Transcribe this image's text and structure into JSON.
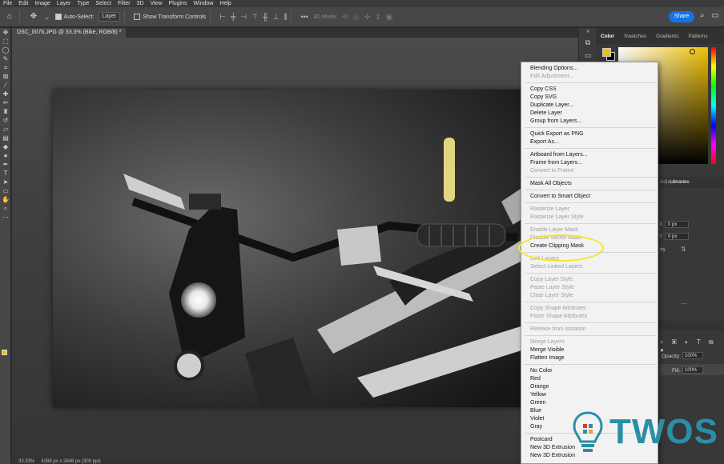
{
  "menubar": {
    "items": [
      "File",
      "Edit",
      "Image",
      "Layer",
      "Type",
      "Select",
      "Filter",
      "3D",
      "View",
      "Plugins",
      "Window",
      "Help"
    ]
  },
  "options": {
    "auto_select_label": "Auto-Select:",
    "auto_select_value": "Layer",
    "show_transform_label": "Show Transform Controls",
    "mode_3d_label": "3D Mode:",
    "share_label": "Share"
  },
  "document": {
    "tab_title": "DSC_0076.JPG @ 33.3% (Bike, RGB/8) *",
    "status_zoom": "33.33%",
    "status_info": "4288 px x 2848 px (300 ppi)"
  },
  "right_panel": {
    "tabs": [
      "Color",
      "Swatches",
      "Gradients",
      "Patterns"
    ],
    "active_tab": "Color",
    "lib_tabs": [
      "Adjustments",
      "Libraries"
    ],
    "x_label": "X",
    "x_value": "0 px",
    "y_label": "Y",
    "y_value": "0 px",
    "opacity_label": "Opacity:",
    "opacity_value": "100%",
    "fill_label": "Fill:",
    "fill_value": "100%"
  },
  "context_menu": {
    "groups": [
      [
        {
          "label": "Blending Options...",
          "enabled": true
        },
        {
          "label": "Edit Adjustment...",
          "enabled": false
        }
      ],
      [
        {
          "label": "Copy CSS",
          "enabled": true
        },
        {
          "label": "Copy SVG",
          "enabled": true
        },
        {
          "label": "Duplicate Layer...",
          "enabled": true
        },
        {
          "label": "Delete Layer",
          "enabled": true
        },
        {
          "label": "Group from Layers...",
          "enabled": true
        }
      ],
      [
        {
          "label": "Quick Export as PNG",
          "enabled": true
        },
        {
          "label": "Export As...",
          "enabled": true
        }
      ],
      [
        {
          "label": "Artboard from Layers...",
          "enabled": true
        },
        {
          "label": "Frame from Layers...",
          "enabled": true
        },
        {
          "label": "Convert to Frame",
          "enabled": false
        }
      ],
      [
        {
          "label": "Mask All Objects",
          "enabled": true
        }
      ],
      [
        {
          "label": "Convert to Smart Object",
          "enabled": true
        }
      ],
      [
        {
          "label": "Rasterize Layer",
          "enabled": false
        },
        {
          "label": "Rasterize Layer Style",
          "enabled": false
        }
      ],
      [
        {
          "label": "Enable Layer Mask",
          "enabled": false
        },
        {
          "label": "Disable Vector Mask",
          "enabled": false
        },
        {
          "label": "Create Clipping Mask",
          "enabled": true
        }
      ],
      [
        {
          "label": "Link Layers",
          "enabled": false
        },
        {
          "label": "Select Linked Layers",
          "enabled": false
        }
      ],
      [
        {
          "label": "Copy Layer Style",
          "enabled": false
        },
        {
          "label": "Paste Layer Style",
          "enabled": false
        },
        {
          "label": "Clear Layer Style",
          "enabled": false
        }
      ],
      [
        {
          "label": "Copy Shape Attributes",
          "enabled": false
        },
        {
          "label": "Paste Shape Attributes",
          "enabled": false
        }
      ],
      [
        {
          "label": "Release from Isolation",
          "enabled": false
        }
      ],
      [
        {
          "label": "Merge Layers",
          "enabled": false
        },
        {
          "label": "Merge Visible",
          "enabled": true
        },
        {
          "label": "Flatten Image",
          "enabled": true
        }
      ],
      [
        {
          "label": "No Color",
          "enabled": true
        },
        {
          "label": "Red",
          "enabled": true
        },
        {
          "label": "Orange",
          "enabled": true
        },
        {
          "label": "Yellow",
          "enabled": true
        },
        {
          "label": "Green",
          "enabled": true
        },
        {
          "label": "Blue",
          "enabled": true
        },
        {
          "label": "Violet",
          "enabled": true
        },
        {
          "label": "Gray",
          "enabled": true
        }
      ],
      [
        {
          "label": "Postcard",
          "enabled": true
        },
        {
          "label": "New 3D Extrusion",
          "enabled": true
        },
        {
          "label": "New 3D Extrusion",
          "enabled": true
        }
      ]
    ]
  },
  "watermark": {
    "text": "TWOS"
  },
  "colors": {
    "accent": "#1473e6",
    "foreground": "#f0c000",
    "highlight": "#f4e52a",
    "watermark": "#2a8fa6"
  }
}
